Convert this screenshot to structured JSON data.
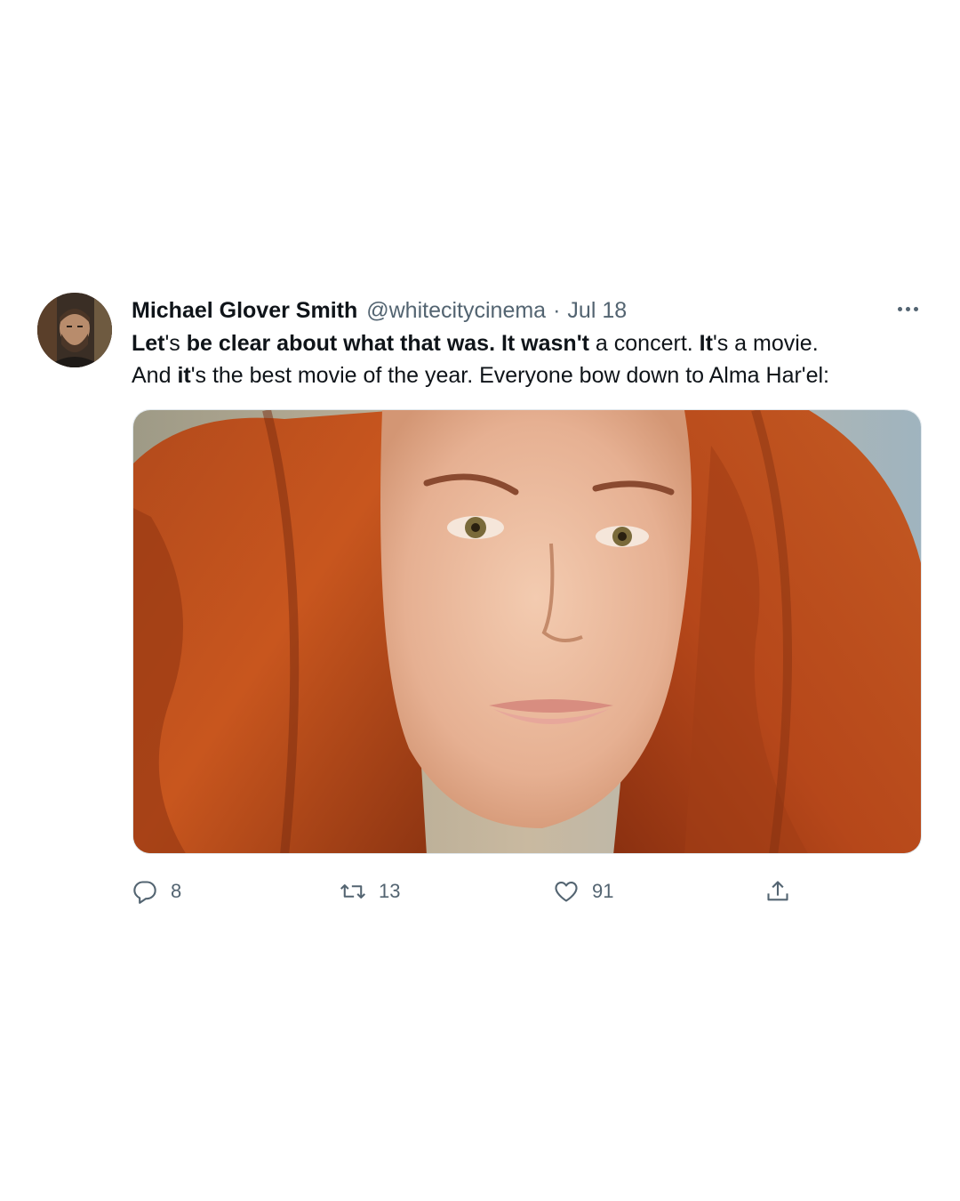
{
  "tweet": {
    "author_name": "Michael Glover Smith",
    "author_handle": "@whitecitycinema",
    "separator": "·",
    "date": "Jul 18",
    "text_line1": [
      {
        "text": "Let",
        "bold": true
      },
      {
        "text": "'s ",
        "bold": false
      },
      {
        "text": "be clear about what that was. It wasn't",
        "bold": true
      },
      {
        "text": " a concert. ",
        "bold": false
      },
      {
        "text": "It",
        "bold": true
      },
      {
        "text": "'s a movie.",
        "bold": false
      }
    ],
    "text_line2": [
      {
        "text": "And ",
        "bold": false
      },
      {
        "text": "it",
        "bold": true
      },
      {
        "text": "'s the best movie of the year. Everyone bow down to Alma Har'el:",
        "bold": false
      }
    ],
    "actions": {
      "reply_count": "8",
      "retweet_count": "13",
      "like_count": "91"
    },
    "icons": {
      "reply": "reply-icon",
      "retweet": "retweet-icon",
      "like": "heart-icon",
      "share": "share-icon",
      "more": "more-icon"
    },
    "colors": {
      "text_primary": "#0f1419",
      "text_secondary": "#536471",
      "background": "#ffffff"
    }
  }
}
